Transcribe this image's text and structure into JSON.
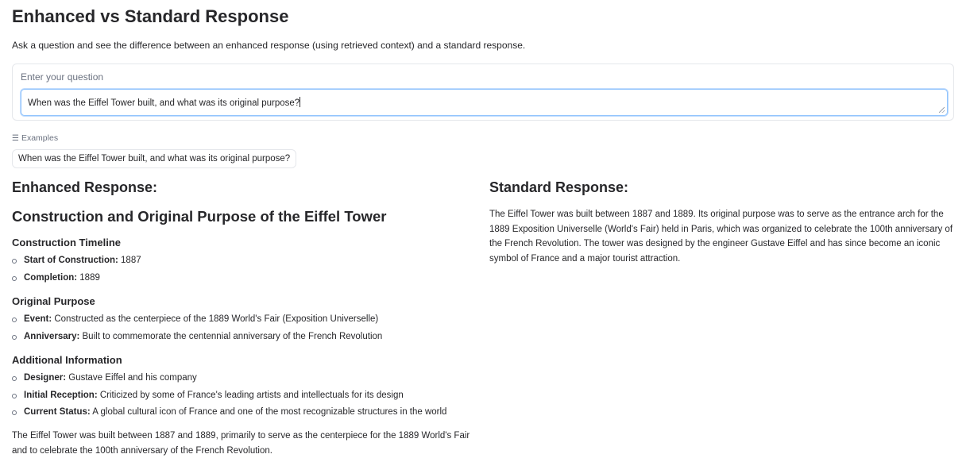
{
  "header": {
    "title": "Enhanced vs Standard Response",
    "description": "Ask a question and see the difference between an enhanced response (using retrieved context) and a standard response."
  },
  "question": {
    "label": "Enter your question",
    "value": "When was the Eiffel Tower built, and what was its original purpose?"
  },
  "examples": {
    "label": "Examples",
    "items": [
      "When was the Eiffel Tower built, and what was its original purpose?"
    ]
  },
  "enhanced": {
    "heading": "Enhanced Response:",
    "title": "Construction and Original Purpose of the Eiffel Tower",
    "sections": [
      {
        "heading": "Construction Timeline",
        "items": [
          {
            "label": "Start of Construction:",
            "text": "1887"
          },
          {
            "label": "Completion:",
            "text": "1889"
          }
        ]
      },
      {
        "heading": "Original Purpose",
        "items": [
          {
            "label": "Event:",
            "text": "Constructed as the centerpiece of the 1889 World's Fair (Exposition Universelle)"
          },
          {
            "label": "Anniversary:",
            "text": "Built to commemorate the centennial anniversary of the French Revolution"
          }
        ]
      },
      {
        "heading": "Additional Information",
        "items": [
          {
            "label": "Designer:",
            "text": "Gustave Eiffel and his company"
          },
          {
            "label": "Initial Reception:",
            "text": "Criticized by some of France's leading artists and intellectuals for its design"
          },
          {
            "label": "Current Status:",
            "text": "A global cultural icon of France and one of the most recognizable structures in the world"
          }
        ]
      }
    ],
    "summary": "The Eiffel Tower was built between 1887 and 1889, primarily to serve as the centerpiece for the 1889 World's Fair and to celebrate the 100th anniversary of the French Revolution."
  },
  "standard": {
    "heading": "Standard Response:",
    "text": "The Eiffel Tower was built between 1887 and 1889. Its original purpose was to serve as the entrance arch for the 1889 Exposition Universelle (World's Fair) held in Paris, which was organized to celebrate the 100th anniversary of the French Revolution. The tower was designed by the engineer Gustave Eiffel and has since become an iconic symbol of France and a major tourist attraction."
  }
}
